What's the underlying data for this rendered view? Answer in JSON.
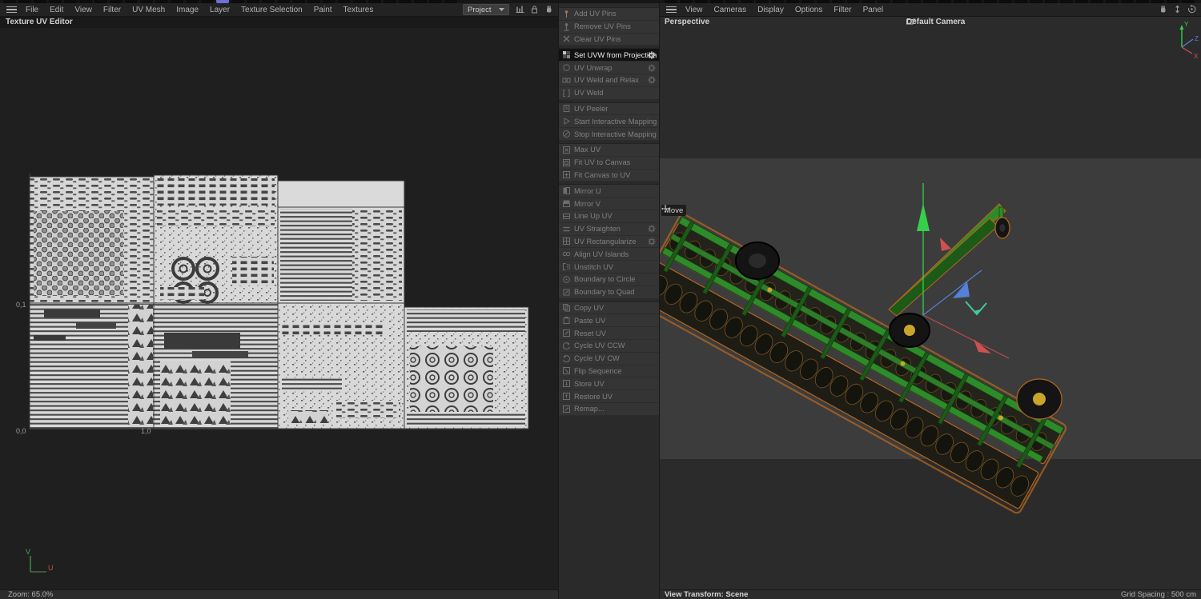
{
  "menus": {
    "left": [
      "File",
      "Edit",
      "View",
      "Filter",
      "UV Mesh",
      "Image",
      "Layer",
      "Texture Selection",
      "Paint",
      "Textures"
    ],
    "right": [
      "View",
      "Cameras",
      "Display",
      "Options",
      "Filter",
      "Panel"
    ]
  },
  "toolbar": {
    "project_label": "Project",
    "left_icons": [
      "histogram-icon",
      "lock-icon",
      "hand-icon",
      "vertical-scroll-icon"
    ],
    "right_corner_icons": [
      "hand-icon",
      "vertical-scroll-icon",
      "orbit-icon",
      "maximize-icon"
    ]
  },
  "left_pane": {
    "title": "Texture UV Editor",
    "coord_labels": {
      "v1": "0,1",
      "origin": "0,0",
      "u1": "1,0"
    },
    "axis": {
      "v": "V",
      "u": "U"
    },
    "status": "Zoom: 65.0%"
  },
  "uv_tools": {
    "groups": [
      {
        "items": [
          {
            "label": "Add UV Pins",
            "icon": "pin-add"
          },
          {
            "label": "Remove UV Pins",
            "icon": "pin-remove"
          },
          {
            "label": "Clear UV Pins",
            "icon": "clear-x"
          }
        ]
      },
      {
        "items": [
          {
            "label": "Set UVW from Projection",
            "icon": "projection-grid",
            "gear": true,
            "active": true
          },
          {
            "label": "UV Unwrap",
            "icon": "unwrap",
            "gear": true
          },
          {
            "label": "UV Weld and Relax",
            "icon": "weld-relax",
            "gear": true
          },
          {
            "label": "UV Weld",
            "icon": "weld"
          }
        ]
      },
      {
        "items": [
          {
            "label": "UV Peeler",
            "icon": "peeler"
          },
          {
            "label": "Start Interactive Mapping",
            "icon": "play"
          },
          {
            "label": "Stop Interactive Mapping",
            "icon": "stop"
          }
        ]
      },
      {
        "items": [
          {
            "label": "Max UV",
            "icon": "max-uv"
          },
          {
            "label": "Fit UV to Canvas",
            "icon": "fit-uv"
          },
          {
            "label": "Fit Canvas to UV",
            "icon": "fit-canvas"
          }
        ]
      },
      {
        "items": [
          {
            "label": "Mirror U",
            "icon": "mirror-u"
          },
          {
            "label": "Mirror V",
            "icon": "mirror-v"
          },
          {
            "label": "Line Up UV",
            "icon": "line-up"
          },
          {
            "label": "UV Straighten",
            "icon": "straighten",
            "gear": true
          },
          {
            "label": "UV Rectangularize",
            "icon": "rectangularize",
            "gear": true
          },
          {
            "label": "Align UV Islands",
            "icon": "align-islands"
          },
          {
            "label": "Unstitch UV",
            "icon": "unstitch"
          },
          {
            "label": "Boundary to Circle",
            "icon": "boundary-circle"
          },
          {
            "label": "Boundary to Quad",
            "icon": "boundary-quad"
          }
        ]
      },
      {
        "items": [
          {
            "label": "Copy UV",
            "icon": "copy"
          },
          {
            "label": "Paste UV",
            "icon": "paste"
          },
          {
            "label": "Reset UV",
            "icon": "reset"
          },
          {
            "label": "Cycle UV CCW",
            "icon": "cycle-ccw"
          },
          {
            "label": "Cycle UV CW",
            "icon": "cycle-cw"
          },
          {
            "label": "Flip Sequence",
            "icon": "flip"
          },
          {
            "label": "Store UV",
            "icon": "store"
          },
          {
            "label": "Restore UV",
            "icon": "restore"
          },
          {
            "label": "Remap...",
            "icon": "remap"
          }
        ]
      }
    ]
  },
  "viewport": {
    "view_label": "Perspective",
    "camera_label": "Default Camera",
    "tool_label": "Move",
    "axis": {
      "x": "X",
      "y": "Y",
      "z": "Z"
    },
    "status_left": "View Transform: Scene",
    "status_right": "Grid Spacing : 500 cm"
  },
  "colors": {
    "accent_tab": "#6f6fd8",
    "uv_tile": "#d6d6d6",
    "pattern_dark": "#484848",
    "harrow_green": "#2e8b2a",
    "harrow_dark_green": "#1c5a17",
    "rim_yellow": "#c9a52a",
    "outline_orange": "#b5651d",
    "tire_black": "#141414",
    "gizmo_x": "#cf5050",
    "gizmo_y": "#35cf4a",
    "gizmo_z": "#5580d8",
    "gizmo_teal": "#3fc9a0",
    "gizmo_v": "#3fae4f",
    "gizmo_u": "#c05050",
    "viewport_band": "#3c3c3c",
    "viewport_dark": "#2b2b2b"
  }
}
